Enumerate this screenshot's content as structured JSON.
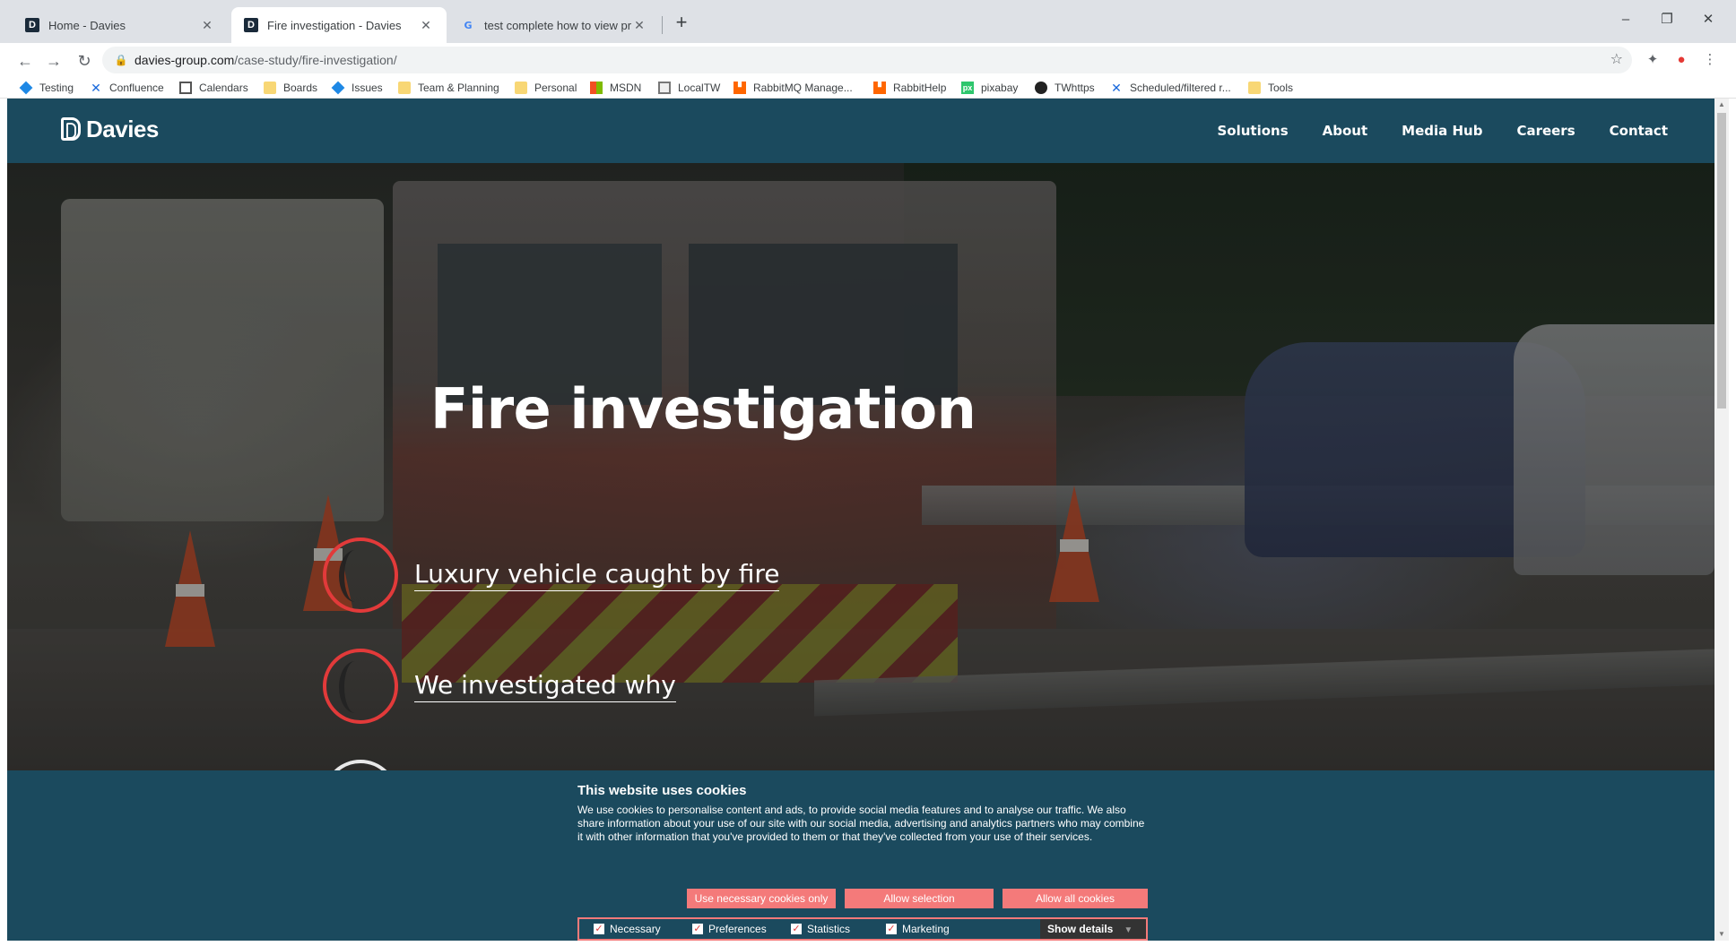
{
  "browser": {
    "tabs": [
      {
        "title": "Home - Davies",
        "icon": "davies-icon",
        "active": false
      },
      {
        "title": "Fire investigation - Davies",
        "icon": "davies-icon",
        "active": true
      },
      {
        "title": "test complete how to view projec",
        "icon": "google-icon",
        "active": false
      }
    ],
    "new_tab_label": "+",
    "window_controls": {
      "minimize": "–",
      "restore": "❐",
      "close": "✕"
    },
    "url_host": "davies-group.com",
    "url_path": "/case-study/fire-investigation/",
    "nav": {
      "back": "←",
      "forward": "→",
      "reload": "↻"
    },
    "bookmarks": [
      {
        "label": "Testing",
        "icon": "diamond"
      },
      {
        "label": "Confluence",
        "icon": "conf"
      },
      {
        "label": "Calendars",
        "icon": "cal"
      },
      {
        "label": "Boards",
        "icon": "folder"
      },
      {
        "label": "Issues",
        "icon": "diamond"
      },
      {
        "label": "Team & Planning",
        "icon": "folder"
      },
      {
        "label": "Personal",
        "icon": "folder"
      },
      {
        "label": "MSDN",
        "icon": "ms"
      },
      {
        "label": "LocalTW",
        "icon": "local"
      },
      {
        "label": "RabbitMQ Manage...",
        "icon": "rabbit"
      },
      {
        "label": "RabbitHelp",
        "icon": "rabbit"
      },
      {
        "label": "pixabay",
        "icon": "px"
      },
      {
        "label": "TWhttps",
        "icon": "tw"
      },
      {
        "label": "Scheduled/filtered r...",
        "icon": "conf"
      },
      {
        "label": "Tools",
        "icon": "folder"
      }
    ]
  },
  "site": {
    "logo_text": "Davies",
    "nav": [
      "Solutions",
      "About",
      "Media Hub",
      "Careers",
      "Contact"
    ]
  },
  "hero": {
    "title": "Fire investigation",
    "steps": [
      "Luxury vehicle caught by fire",
      "We investigated why"
    ]
  },
  "cookie_banner": {
    "title": "This website uses cookies",
    "text": "We use cookies to personalise content and ads, to provide social media features and to analyse our traffic. We also share information about your use of our site with our social media, advertising and analytics partners who may combine it with other information that you've provided to them or that they've collected from your use of their services.",
    "buttons": {
      "necessary_only": "Use necessary cookies only",
      "allow_selection": "Allow selection",
      "allow_all": "Allow all cookies"
    },
    "options": [
      {
        "label": "Necessary",
        "checked": true
      },
      {
        "label": "Preferences",
        "checked": true
      },
      {
        "label": "Statistics",
        "checked": true
      },
      {
        "label": "Marketing",
        "checked": true
      }
    ],
    "show_details": "Show details",
    "accent_color": "#f47a7a",
    "background_color": "#1b4a5e"
  }
}
